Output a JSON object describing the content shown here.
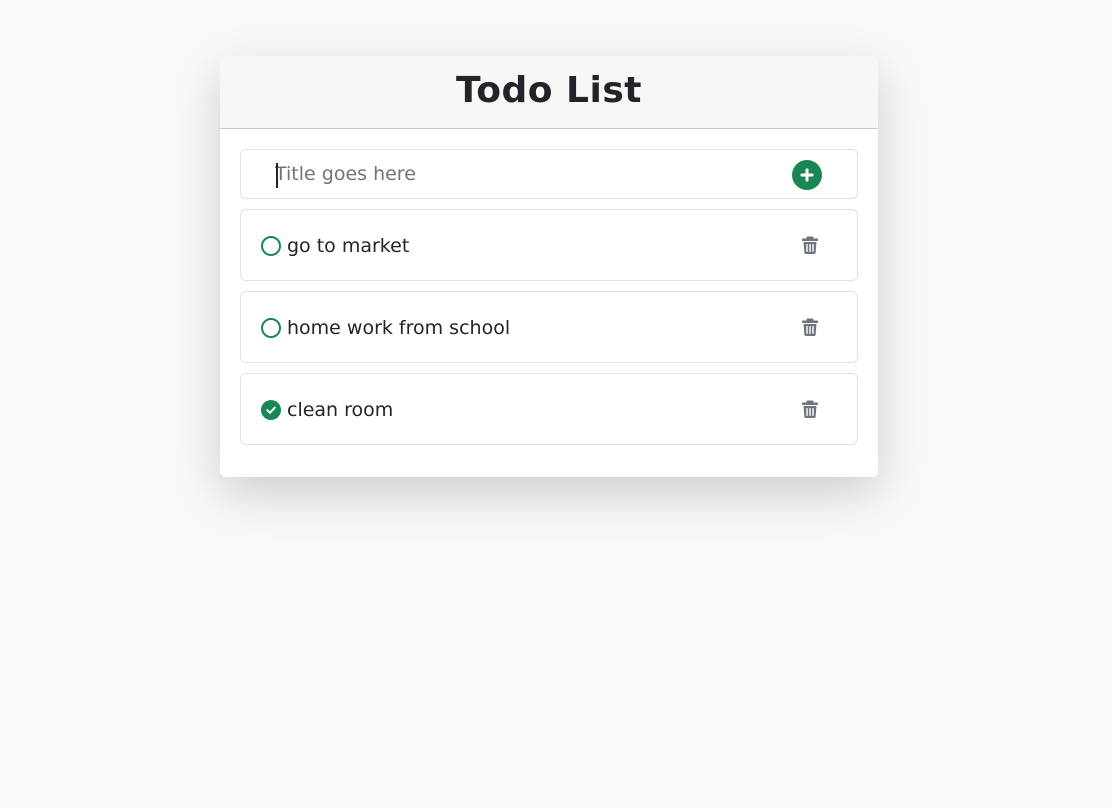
{
  "app": {
    "title": "Todo List"
  },
  "new_todo": {
    "placeholder": "Title goes here",
    "value": ""
  },
  "todos": [
    {
      "title": "go to market",
      "done": false
    },
    {
      "title": "home work from school",
      "done": false
    },
    {
      "title": "clean room",
      "done": true
    }
  ],
  "icons": {
    "add": "plus-circle-icon",
    "unchecked": "circle-icon",
    "checked": "check-circle-icon",
    "delete": "trash-icon"
  },
  "colors": {
    "accent": "#198754",
    "icon_gray": "#6c757d",
    "page_bg": "#f8f9fa"
  }
}
